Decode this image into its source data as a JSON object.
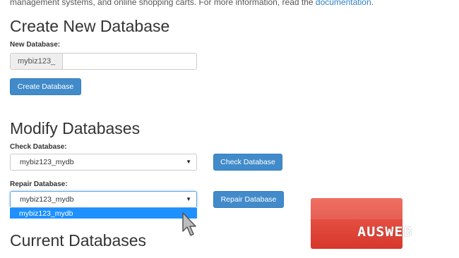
{
  "intro": {
    "text": "management systems, and online shopping carts. For more information, read the ",
    "link": "documentation",
    "end": "."
  },
  "create": {
    "heading": "Create New Database",
    "new_db_label": "New Database:",
    "prefix": "mybiz123_",
    "input_value": "",
    "button": "Create Database"
  },
  "modify": {
    "heading": "Modify Databases",
    "check_label": "Check Database:",
    "check_selected": "mybiz123_mydb",
    "check_button": "Check Database",
    "repair_label": "Repair Database:",
    "repair_selected": "mybiz123_mydb",
    "repair_button": "Repair Database",
    "repair_options": [
      "mybiz123_mydb"
    ]
  },
  "current": {
    "heading": "Current Databases"
  },
  "watermark": {
    "text": "AUSWEB",
    "color": "#e0483c"
  },
  "icons": {
    "caret": "caret-down-icon",
    "cursor": "mouse-pointer-icon"
  }
}
